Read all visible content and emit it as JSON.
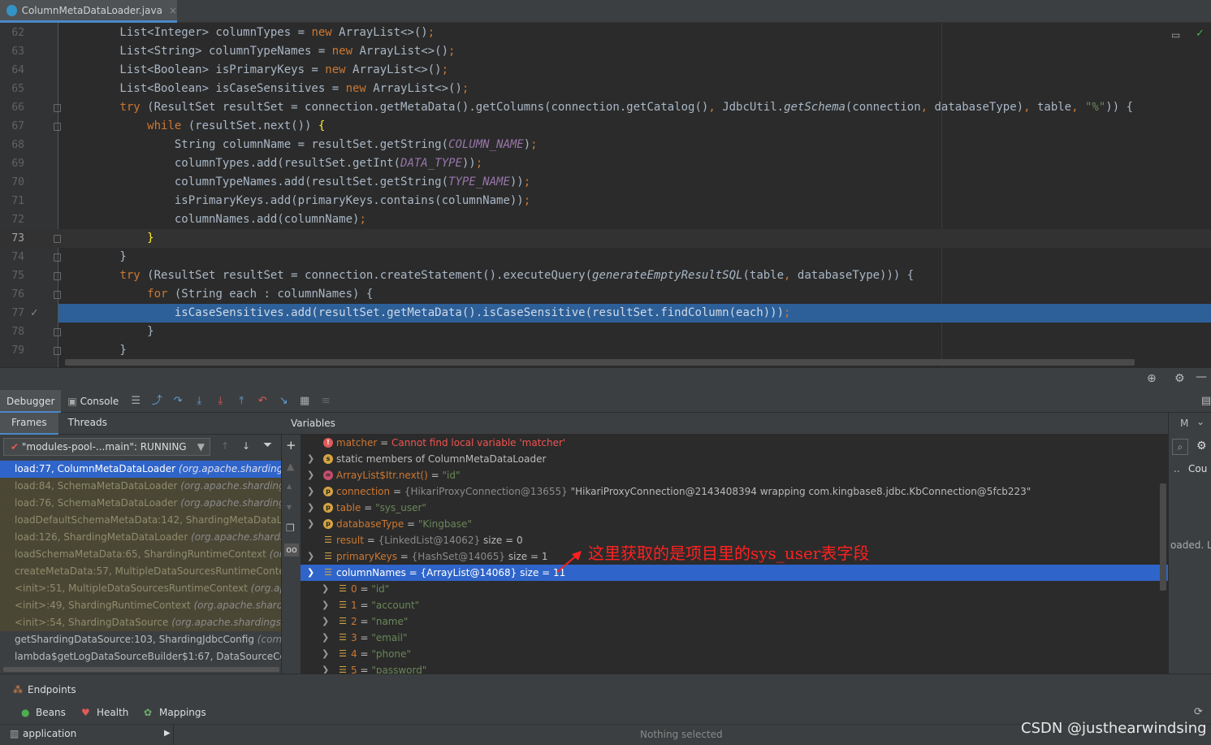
{
  "tab": {
    "filename": "ColumnMetaDataLoader.java",
    "close": "×"
  },
  "editor": {
    "lines": [
      {
        "n": "62"
      },
      {
        "n": "63"
      },
      {
        "n": "64"
      },
      {
        "n": "65"
      },
      {
        "n": "66"
      },
      {
        "n": "67"
      },
      {
        "n": "68"
      },
      {
        "n": "69"
      },
      {
        "n": "70"
      },
      {
        "n": "71"
      },
      {
        "n": "72"
      },
      {
        "n": "73"
      },
      {
        "n": "74"
      },
      {
        "n": "75"
      },
      {
        "n": "76"
      },
      {
        "n": "77"
      },
      {
        "n": "78"
      },
      {
        "n": "79"
      }
    ]
  },
  "debugger": {
    "tabs": {
      "debugger": "Debugger",
      "console": "Console"
    },
    "sub_tabs": {
      "frames": "Frames",
      "threads": "Threads"
    },
    "variables_title": "Variables",
    "thread": "\"modules-pool-...main\": RUNNING",
    "frames": [
      {
        "method": "load:77, ColumnMetaDataLoader",
        "pkg": "(org.apache.shardings"
      },
      {
        "method": "load:84, SchemaMetaDataLoader",
        "pkg": "(org.apache.shardings"
      },
      {
        "method": "load:76, SchemaMetaDataLoader",
        "pkg": "(org.apache.shardings"
      },
      {
        "method": "loadDefaultSchemaMetaData:142, ShardingMetaDataLo",
        "pkg": ""
      },
      {
        "method": "load:126, ShardingMetaDataLoader",
        "pkg": "(org.apache.shardi"
      },
      {
        "method": "loadSchemaMetaData:65, ShardingRuntimeContext",
        "pkg": "(org."
      },
      {
        "method": "createMetaData:57, MultipleDataSourcesRuntimeContext",
        "pkg": ""
      },
      {
        "method": "<init>:51, MultipleDataSourcesRuntimeContext",
        "pkg": "(org.apa"
      },
      {
        "method": "<init>:49, ShardingRuntimeContext",
        "pkg": "(org.apache.sharding"
      },
      {
        "method": "<init>:54, ShardingDataSource",
        "pkg": "(org.apache.shardingsph"
      },
      {
        "method": "getShardingDataSource:103, ShardingJdbcConfig",
        "pkg": "(com.t"
      },
      {
        "method": "lambda$getLogDataSourceBuilder$1:67, DataSourceCon",
        "pkg": ""
      }
    ],
    "variables": [
      {
        "name": "matcher",
        "eq": " = ",
        "value": "Cannot find local variable 'matcher'"
      },
      {
        "name": "static members of ColumnMetaDataLoader"
      },
      {
        "name": "ArrayList$Itr.next()",
        "eq": " = ",
        "value": "\"id\""
      },
      {
        "name": "connection",
        "eq": " = ",
        "ref": "{HikariProxyConnection@13655}",
        "value": " \"HikariProxyConnection@2143408394 wrapping com.kingbase8.jdbc.KbConnection@5fcb223\""
      },
      {
        "name": "table",
        "eq": " = ",
        "value": "\"sys_user\""
      },
      {
        "name": "databaseType",
        "eq": " = ",
        "value": "\"Kingbase\""
      },
      {
        "name": "result",
        "eq": " = ",
        "ref": "{LinkedList@14062}",
        "value": "  size = 0"
      },
      {
        "name": "primaryKeys",
        "eq": " = ",
        "ref": "{HashSet@14065}",
        "value": "  size = 1"
      },
      {
        "name": "columnNames",
        "eq": " = ",
        "ref": "{ArrayList@14068}",
        "value": "  size = 11"
      },
      {
        "name": "0",
        "eq": " = ",
        "value": "\"id\""
      },
      {
        "name": "1",
        "eq": " = ",
        "value": "\"account\""
      },
      {
        "name": "2",
        "eq": " = ",
        "value": "\"name\""
      },
      {
        "name": "3",
        "eq": " = ",
        "value": "\"email\""
      },
      {
        "name": "4",
        "eq": " = ",
        "value": "\"phone\""
      },
      {
        "name": "5",
        "eq": " = ",
        "value": "\"password\""
      }
    ],
    "annotation": "这里获取的是项目里的sys_user表字段",
    "right_panel": {
      "m": "M",
      "cou": "Cou",
      "dots": "..",
      "loaded": "oaded. L"
    }
  },
  "bottom": {
    "endpoints": "Endpoints",
    "beans": "Beans",
    "health": "Health",
    "mappings": "Mappings",
    "application": "application"
  },
  "status": {
    "text": "Nothing selected",
    "watermark": "CSDN @justhearwindsing"
  },
  "colors": {
    "selection": "#2f65ca",
    "keyword": "#cc7832",
    "string": "#6a8759"
  }
}
